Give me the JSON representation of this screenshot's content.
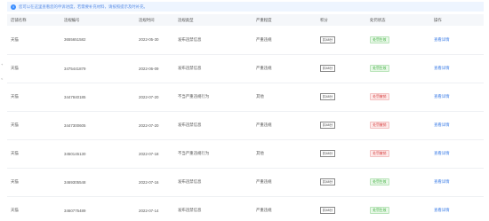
{
  "notice": {
    "icon": "info-icon",
    "text": "您可以在这里查看您的申诉进度，若需要补充材料，请按照提示及时补充。"
  },
  "edge_marks": [
    "+",
    "<"
  ],
  "table": {
    "headers": [
      "店铺名称",
      "违规编号",
      "违规时间",
      "违规类型",
      "严重程度",
      "积分",
      "处罚状态",
      "操作"
    ],
    "rows": [
      {
        "shop": "天猫",
        "id": "3655651582",
        "date": "2022-05-30",
        "type": "发布违禁信息",
        "severity": "严重违规",
        "points": "扣48分",
        "status": "处罚生效",
        "status_kind": "ok",
        "action": "查看详情"
      },
      {
        "shop": "天猫",
        "id": "3475441879",
        "date": "2022-06-09",
        "type": "发布违禁信息",
        "severity": "严重违规",
        "points": "扣48分",
        "status": "处罚生效",
        "status_kind": "ok",
        "action": "查看详情"
      },
      {
        "shop": "天猫",
        "id": "3447840185",
        "date": "2022-07-20",
        "type": "不当严重违规行为",
        "severity": "其他",
        "points": "扣48分",
        "status": "处罚撤销",
        "status_kind": "fail",
        "action": "查看详情"
      },
      {
        "shop": "天猫",
        "id": "3447300605",
        "date": "2022-07-20",
        "type": "发布违禁信息",
        "severity": "严重违规",
        "points": "扣48分",
        "status": "处罚撤销",
        "status_kind": "fail",
        "action": "查看详情"
      },
      {
        "shop": "天猫",
        "id": "3450145130",
        "date": "2022-07-18",
        "type": "不当严重违规行为",
        "severity": "其他",
        "points": "扣48分",
        "status": "处罚撤销",
        "status_kind": "fail",
        "action": "查看详情"
      },
      {
        "shop": "天猫",
        "id": "3469305548",
        "date": "2022-07-16",
        "type": "发布违禁信息",
        "severity": "严重违规",
        "points": "扣48分",
        "status": "处罚生效",
        "status_kind": "ok",
        "action": "查看详情"
      },
      {
        "shop": "天猫",
        "id": "3460775489",
        "date": "2022-07-14",
        "type": "发布违禁信息",
        "severity": "严重违规",
        "points": "扣48分",
        "status": "处罚生效",
        "status_kind": "ok",
        "action": "查看详情"
      }
    ]
  },
  "colors": {
    "accent": "#3a7ce6",
    "ok": "#3fae3f",
    "fail": "#d84545"
  }
}
